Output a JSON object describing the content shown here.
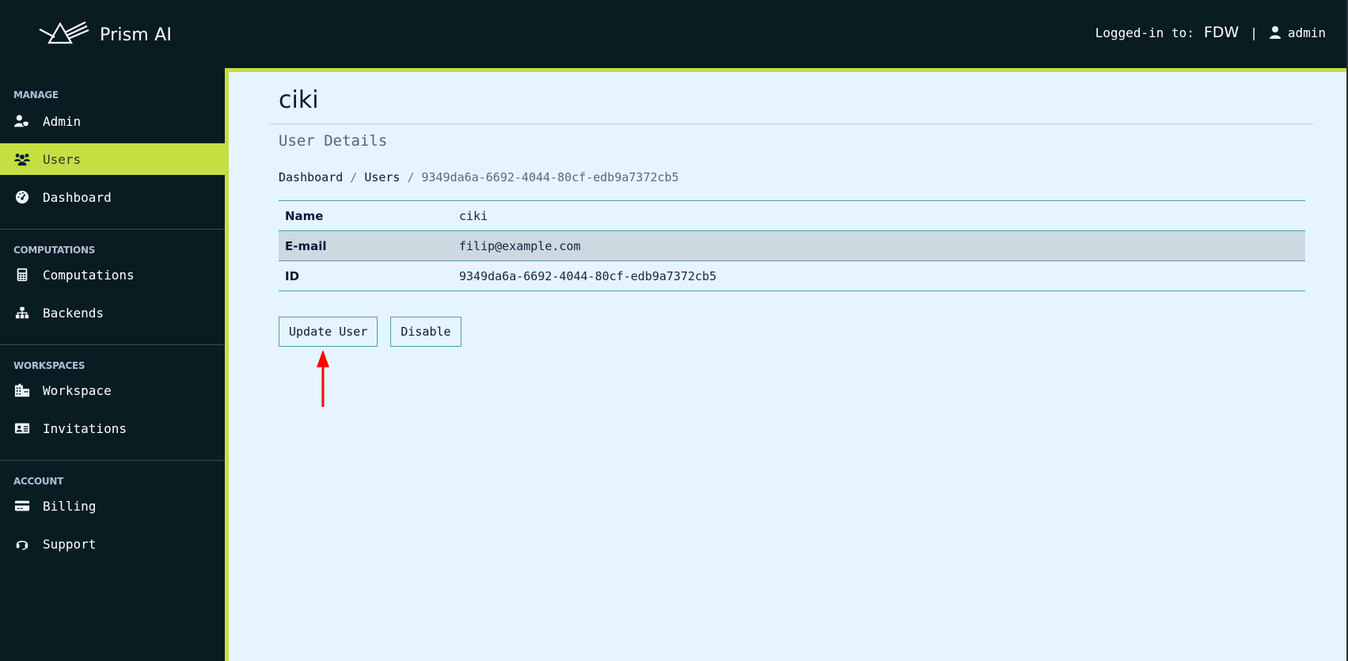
{
  "header": {
    "app_name": "Prism AI",
    "logged_in_label": "Logged-in to:",
    "tenant": "FDW",
    "separator": "|",
    "username": "admin"
  },
  "sidebar": {
    "sections": [
      {
        "title": "MANAGE",
        "items": [
          {
            "label": "Admin",
            "icon": "user-shield-icon",
            "active": false
          },
          {
            "label": "Users",
            "icon": "users-icon",
            "active": true
          },
          {
            "label": "Dashboard",
            "icon": "gauge-icon",
            "active": false
          }
        ]
      },
      {
        "title": "COMPUTATIONS",
        "items": [
          {
            "label": "Computations",
            "icon": "calculator-icon",
            "active": false
          },
          {
            "label": "Backends",
            "icon": "sitemap-icon",
            "active": false
          }
        ]
      },
      {
        "title": "WORKSPACES",
        "items": [
          {
            "label": "Workspace",
            "icon": "city-icon",
            "active": false
          },
          {
            "label": "Invitations",
            "icon": "id-card-icon",
            "active": false
          }
        ]
      },
      {
        "title": "ACCOUNT",
        "items": [
          {
            "label": "Billing",
            "icon": "credit-card-icon",
            "active": false
          },
          {
            "label": "Support",
            "icon": "headset-icon",
            "active": false
          }
        ]
      }
    ]
  },
  "main": {
    "title": "ciki",
    "subtitle": "User Details",
    "breadcrumb": [
      {
        "label": "Dashboard"
      },
      {
        "label": "Users"
      },
      {
        "label": "9349da6a-6692-4044-80cf-edb9a7372cb5"
      }
    ],
    "breadcrumb_separator": "/",
    "details": [
      {
        "key": "Name",
        "value": "ciki"
      },
      {
        "key": "E-mail",
        "value": "filip@example.com"
      },
      {
        "key": "ID",
        "value": "9349da6a-6692-4044-80cf-edb9a7372cb5"
      }
    ],
    "actions": {
      "update_label": "Update User",
      "disable_label": "Disable"
    }
  },
  "colors": {
    "accent": "#c5de40",
    "dark_bg": "#081c22",
    "content_bg": "#e5f4fe",
    "table_border": "#4ea0a6",
    "annotation_arrow": "#ff0000"
  }
}
